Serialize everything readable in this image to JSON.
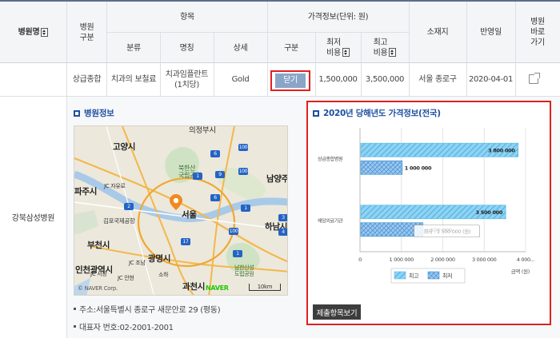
{
  "header": {
    "hospital_name": "병원명",
    "hospital_type": "병원\n구분",
    "items_group": "항목",
    "category": "분류",
    "item_name": "명칭",
    "detail": "상세",
    "price_group": "가격정보(단위: 원)",
    "price_type": "구분",
    "min_cost": "최저\n비용",
    "max_cost": "최고\n비용",
    "location": "소재지",
    "updated": "반영일",
    "shortcut": "병원\n바로\n가기"
  },
  "row": {
    "hospital": "강북삼성병원",
    "type": "상급종합",
    "category": "치과의 보철료",
    "name": "치과임플란트\n(1치당)",
    "detail": "Gold",
    "close_label": "닫기",
    "min_cost": "1,500,000",
    "max_cost": "3,500,000",
    "location": "서울 종로구",
    "updated": "2020-04-01"
  },
  "hospital_info": {
    "title": "병원정보",
    "address": "주소:서울특별시 종로구 새문안로 29 (평동)",
    "phone": "대표자 번호:02-2001-2001"
  },
  "map": {
    "labels": [
      "의정부시",
      "북한산\n국립공원",
      "고양시",
      "파주시",
      "JC 자유로",
      "남양주시",
      "서울",
      "김포국제공항",
      "부천시",
      "하남시",
      "광명시",
      "인천광역시",
      "남한산성\n도립공원",
      "과천시",
      "JC 서창",
      "JC 안현",
      "JC 조남",
      "소하"
    ],
    "credits": "© NAVER Corp.",
    "brand": "NAVER",
    "scale": "10km",
    "road_badges": [
      "100",
      "6",
      "9",
      "1",
      "100",
      "6",
      "4",
      "1",
      "3",
      "100",
      "1",
      "17",
      "2"
    ],
    "pin_icon": "map-pin-icon"
  },
  "price_chart": {
    "title": "2020년 당해년도 가격정보(전국)",
    "submit_label": "제출항목보기",
    "legend_max": "최고",
    "legend_min": "최저",
    "tooltip": "최저 : 1 500 000 (원)",
    "colors": {
      "max": "#5fc0ea",
      "min": "#4a9ad4",
      "tooltip_border": "#999"
    }
  },
  "chart_data": {
    "type": "bar",
    "orientation": "horizontal",
    "categories": [
      "상급종합병원",
      "해당의료기관"
    ],
    "series": [
      {
        "name": "최고",
        "values": [
          3800000,
          3500000
        ]
      },
      {
        "name": "최저",
        "values": [
          1000000,
          1500000
        ]
      }
    ],
    "value_labels": {
      "최고": [
        "3 800 000",
        "3 500 000"
      ],
      "최저": [
        "1 000 000",
        "1 500 000"
      ]
    },
    "xlabel": "금액 (원)",
    "xticks": [
      "0",
      "1 000 000",
      "2 000 000",
      "3 000 000",
      "4 000..."
    ],
    "xlim": [
      0,
      4000000
    ],
    "grid": true,
    "legend_position": "bottom"
  }
}
